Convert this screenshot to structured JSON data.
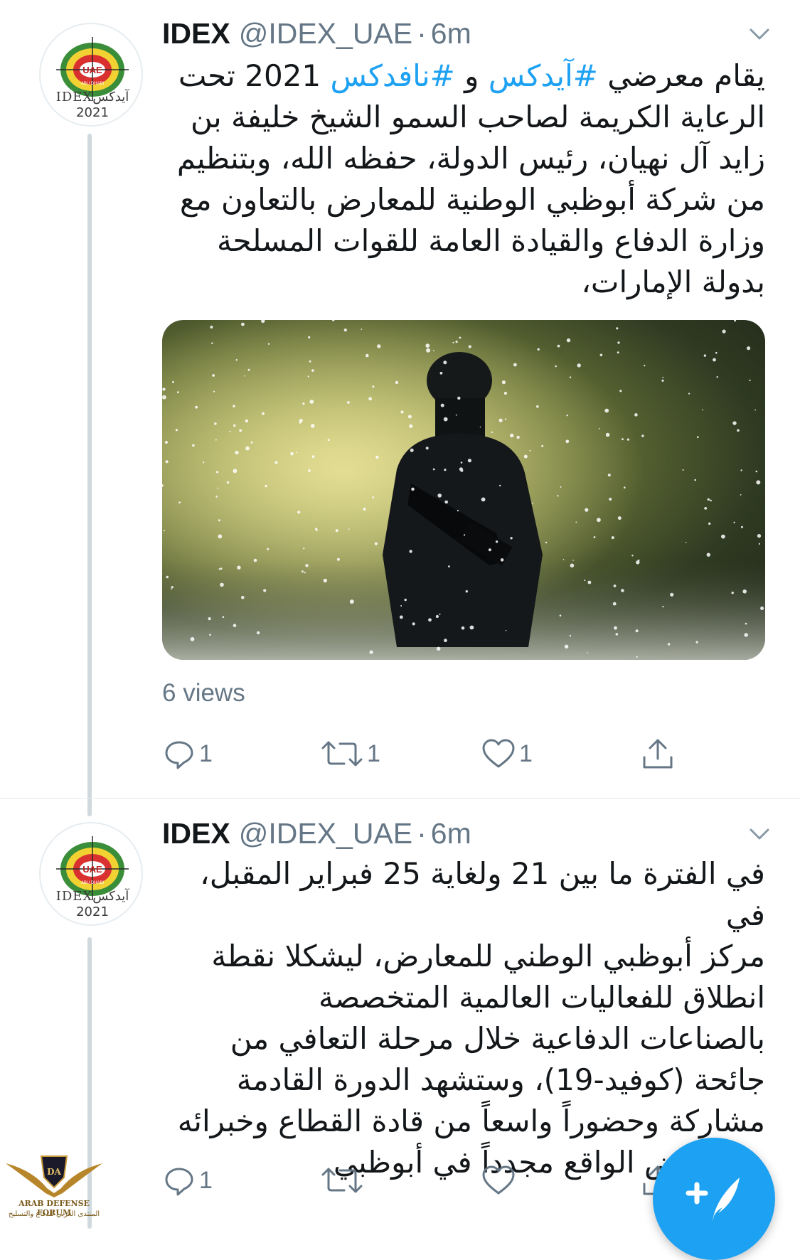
{
  "tweets": [
    {
      "author": {
        "name": "IDEX",
        "handle": "@IDEX_UAE",
        "time": "6m"
      },
      "avatar": {
        "badge": "UAE",
        "sub": "ABU DHABI",
        "brand": "IDEXآيدكس",
        "year": "2021"
      },
      "text_lines": [
        [
          "يقام معرضي ",
          {
            "tag": "#آيدكس"
          },
          " و ",
          {
            "tag": "#نافدكس"
          },
          " 2021 تحت"
        ],
        [
          "الرعاية الكريمة لصاحب السمو الشيخ خليفة بن"
        ],
        [
          "زايد آل نهيان، رئيس الدولة، حفظه الله، وبتنظيم"
        ],
        [
          "من شركة أبوظبي الوطنية للمعارض بالتعاون مع"
        ],
        [
          "وزارة الدفاع والقيادة العامة للقوات المسلحة"
        ],
        [
          "بدولة الإمارات،"
        ]
      ],
      "views": "6 views",
      "stats": {
        "replies": "1",
        "retweets": "1",
        "likes": "1"
      }
    },
    {
      "author": {
        "name": "IDEX",
        "handle": "@IDEX_UAE",
        "time": "6m"
      },
      "avatar": {
        "badge": "UAE",
        "sub": "ABU DHABI",
        "brand": "IDEXآيدكس",
        "year": "2021"
      },
      "text_lines": [
        [
          "في الفترة ما بين 21 ولغاية 25 فبراير المقبل، في"
        ],
        [
          "مركز أبوظبي الوطني للمعارض، ليشكلا نقطة"
        ],
        [
          "انطلاق للفعاليات العالمية المتخصصة"
        ],
        [
          "بالصناعات الدفاعية خلال مرحلة التعافي من"
        ],
        [
          "جائحة (كوفيد-19)، وستشهد الدورة القادمة"
        ],
        [
          "مشاركة وحضوراً واسعاً من قادة القطاع وخبرائه"
        ],
        [
          "على أرض الواقع مجدداً في أبوظبي"
        ]
      ],
      "stats": {
        "replies": "1",
        "retweets": "",
        "likes": ""
      }
    }
  ],
  "watermark": {
    "line1": "ARAB DEFENSE FORUM",
    "line2": "المنتدى العربي للدفاع والتسليح",
    "mark": "DA"
  },
  "colors": {
    "accent": "#1da1f2",
    "muted": "#657786",
    "text": "#14171a"
  },
  "icons": {
    "compose": "feather-plus-icon",
    "reply": "reply-icon",
    "retweet": "retweet-icon",
    "like": "heart-icon",
    "share": "share-icon",
    "caret": "chevron-down-icon"
  }
}
